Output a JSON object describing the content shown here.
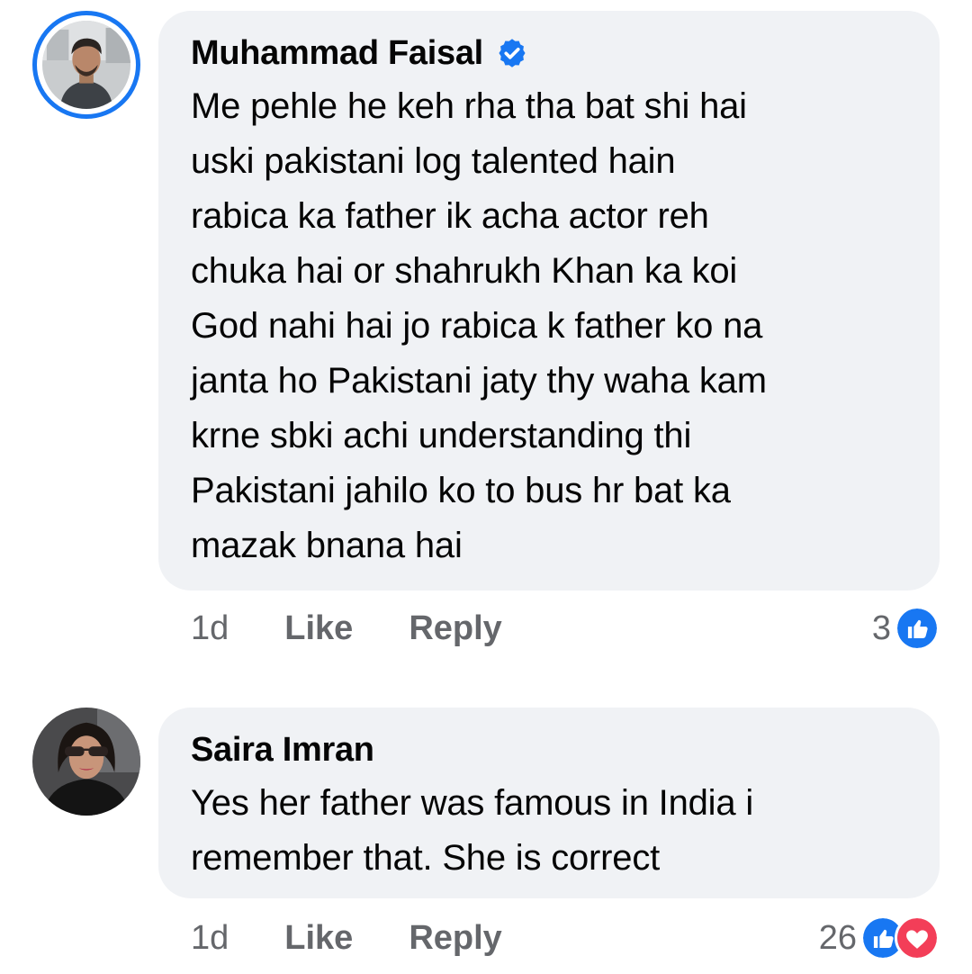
{
  "colors": {
    "accent": "#1877f2",
    "bubble_bg": "#f0f2f5",
    "meta_text": "#65676b",
    "love": "#f33e58"
  },
  "comments": [
    {
      "author": "Muhammad Faisal",
      "verified": true,
      "avatar_icon": "profile-photo-man",
      "has_story_ring": true,
      "text": "Me pehle he keh rha tha bat shi hai\nuski pakistani log talented hain\nrabica ka father ik acha actor reh\nchuka hai or shahrukh Khan ka koi\nGod nahi hai jo rabica k father ko na\njanta ho Pakistani jaty thy waha kam\nkrne sbki achi understanding thi\nPakistani jahilo ko to bus hr bat ka\nmazak bnana hai",
      "time": "1d",
      "like_label": "Like",
      "reply_label": "Reply",
      "reaction_count": "3",
      "reactions": [
        "like-icon"
      ]
    },
    {
      "author": "Saira Imran",
      "verified": false,
      "avatar_icon": "profile-photo-woman",
      "has_story_ring": false,
      "text": "Yes her father was famous in India i\nremember that. She is correct",
      "time": "1d",
      "like_label": "Like",
      "reply_label": "Reply",
      "reaction_count": "26",
      "reactions": [
        "like-icon",
        "love-icon"
      ]
    }
  ]
}
